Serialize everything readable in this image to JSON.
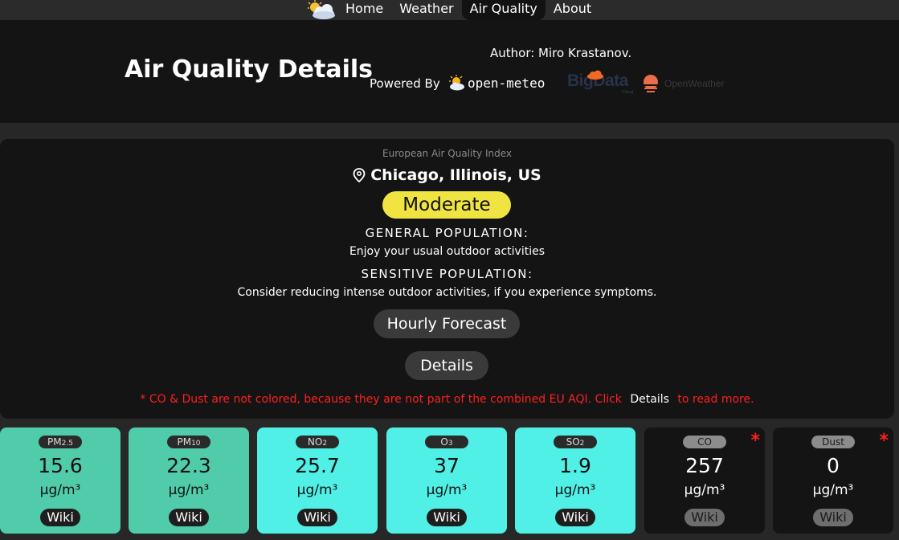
{
  "nav": {
    "items": [
      {
        "label": "Home"
      },
      {
        "label": "Weather"
      },
      {
        "label": "Air Quality"
      },
      {
        "label": "About"
      }
    ],
    "active": "Air Quality"
  },
  "header": {
    "title": "Air Quality Details",
    "author": "Author: Miro Krastanov.",
    "powered_by": "Powered By",
    "brands": {
      "open_meteo": "open-meteo",
      "bigdata": "BigData",
      "bigdata_sub": "Cloud",
      "openweather": "OpenWeather"
    }
  },
  "aqi": {
    "index_name": "European Air Quality Index",
    "location": "Chicago, Illinois, US",
    "level": "Moderate",
    "level_color": "#f0e442",
    "general_heading": "GENERAL POPULATION:",
    "general_text": "Enjoy your usual outdoor activities",
    "sensitive_heading": "SENSITIVE POPULATION:",
    "sensitive_text": "Consider reducing intense outdoor activities, if you experience symptoms.",
    "hourly_button": "Hourly Forecast",
    "details_button": "Details",
    "footnote_pre": "* CO & Dust are not colored, because they are not part of the combined EU AQI. Click",
    "footnote_link": "Details",
    "footnote_post": "to read more."
  },
  "pollutants": [
    {
      "name": "PM",
      "sub": "2.5",
      "value": "15.6",
      "unit": "μg/m³",
      "wiki": "Wiki",
      "color": "#50ccaa",
      "note": ""
    },
    {
      "name": "PM",
      "sub": "10",
      "value": "22.3",
      "unit": "μg/m³",
      "wiki": "Wiki",
      "color": "#50ccaa",
      "note": ""
    },
    {
      "name": "NO",
      "sub": "2",
      "value": "25.7",
      "unit": "μg/m³",
      "wiki": "Wiki",
      "color": "#50f0e6",
      "note": ""
    },
    {
      "name": "O",
      "sub": "3",
      "value": "37",
      "unit": "μg/m³",
      "wiki": "Wiki",
      "color": "#50f0e6",
      "note": ""
    },
    {
      "name": "SO",
      "sub": "2",
      "value": "1.9",
      "unit": "μg/m³",
      "wiki": "Wiki",
      "color": "#50f0e6",
      "note": ""
    },
    {
      "name": "CO",
      "sub": "",
      "value": "257",
      "unit": "μg/m³",
      "wiki": "Wiki",
      "color": "",
      "note": "*"
    },
    {
      "name": "Dust",
      "sub": "",
      "value": "0",
      "unit": "μg/m³",
      "wiki": "Wiki",
      "color": "",
      "note": "*"
    }
  ],
  "colors": {
    "page_bg": "#272727",
    "panel_bg": "#141414",
    "good": "#50ccaa",
    "fair": "#50f0e6",
    "moderate": "#f0e442",
    "footnote": "#ff1f1f"
  }
}
